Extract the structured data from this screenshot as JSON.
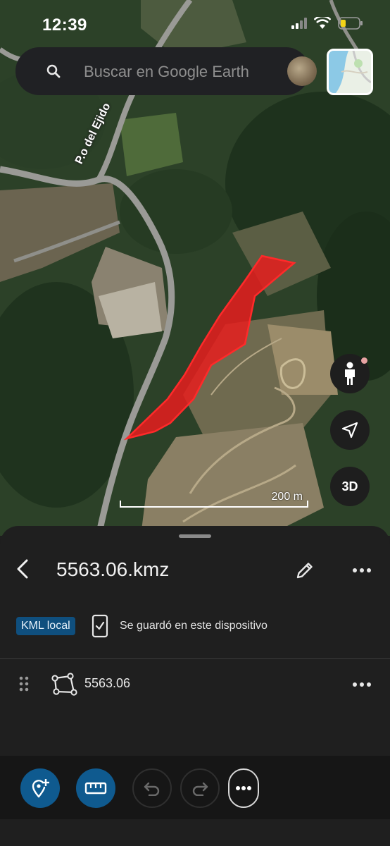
{
  "status_bar": {
    "time": "12:39"
  },
  "search": {
    "placeholder": "Buscar en Google Earth"
  },
  "map": {
    "street_label": "P.o del Ejido",
    "scale_label": "200 m",
    "polygon_fill": "#e81d1d",
    "buttons": {
      "three_d": "3D"
    }
  },
  "sheet": {
    "title": "5563.06.kmz",
    "kml_badge": "KML local",
    "saved_status": "Se guardó en este dispositivo",
    "feature": {
      "name": "5563.06",
      "type_icon": "polygon-icon"
    }
  },
  "toolbar": {
    "items": [
      "add-place-icon",
      "ruler-icon",
      "undo-icon",
      "redo-icon",
      "more-icon"
    ]
  },
  "colors": {
    "accent": "#0f5a8f",
    "badge": "#0f4f7e",
    "sheet_bg": "#1f1f1f"
  }
}
